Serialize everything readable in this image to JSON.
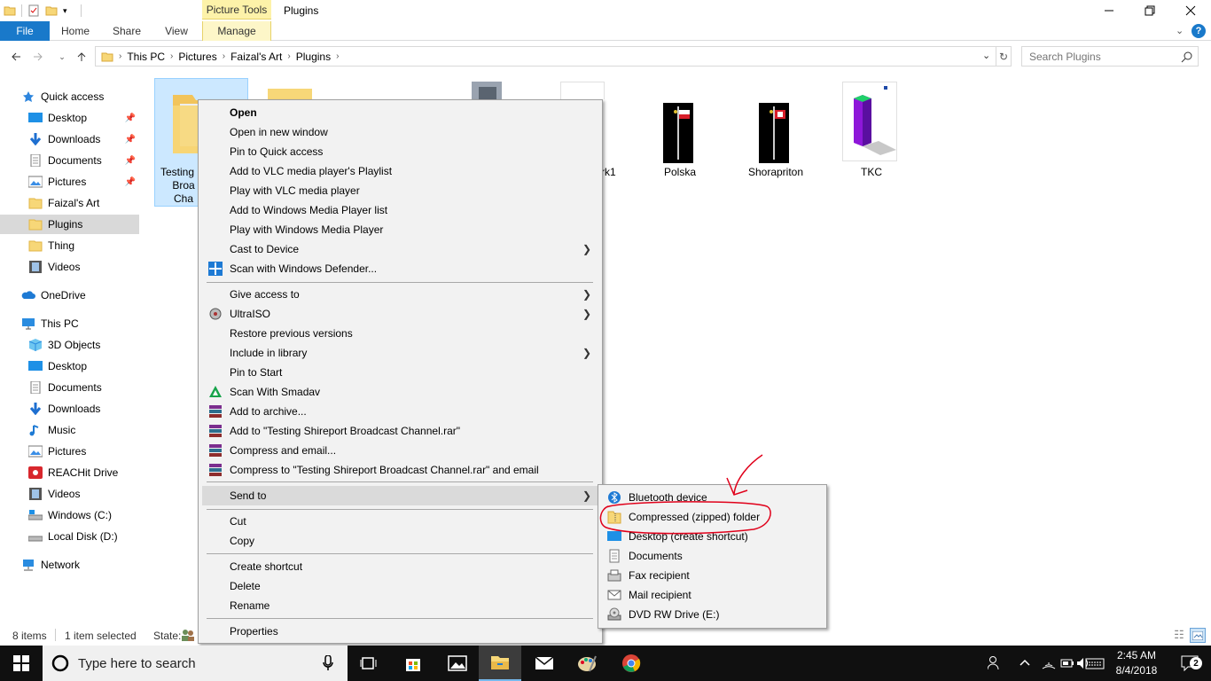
{
  "window": {
    "title": "Plugins",
    "context_tab_group": "Picture Tools",
    "controls": {
      "minimize": "—",
      "maximize": "☐",
      "close": "✕"
    }
  },
  "ribbon": {
    "tabs": [
      {
        "label": "File"
      },
      {
        "label": "Home"
      },
      {
        "label": "Share"
      },
      {
        "label": "View"
      },
      {
        "label": "Manage"
      }
    ]
  },
  "address": {
    "crumbs": [
      "This PC",
      "Pictures",
      "Faizal's Art",
      "Plugins"
    ],
    "search_placeholder": "Search Plugins"
  },
  "nav": {
    "items": [
      {
        "label": "Quick access",
        "icon": "star-icon"
      },
      {
        "label": "Desktop",
        "icon": "desktop-icon",
        "pinned": true
      },
      {
        "label": "Downloads",
        "icon": "download-icon",
        "pinned": true
      },
      {
        "label": "Documents",
        "icon": "documents-icon",
        "pinned": true
      },
      {
        "label": "Pictures",
        "icon": "pictures-icon",
        "pinned": true
      },
      {
        "label": "Faizal's Art",
        "icon": "folder-icon"
      },
      {
        "label": "Plugins",
        "icon": "folder-icon",
        "selected": true
      },
      {
        "label": "Thing",
        "icon": "folder-icon"
      },
      {
        "label": "Videos",
        "icon": "videos-icon"
      },
      {
        "label": "OneDrive",
        "icon": "cloud-icon"
      },
      {
        "label": "This PC",
        "icon": "pc-icon"
      },
      {
        "label": "3D Objects",
        "icon": "cube-icon"
      },
      {
        "label": "Desktop",
        "icon": "desktop-icon"
      },
      {
        "label": "Documents",
        "icon": "documents-icon"
      },
      {
        "label": "Downloads",
        "icon": "download-icon"
      },
      {
        "label": "Music",
        "icon": "music-icon"
      },
      {
        "label": "Pictures",
        "icon": "pictures-icon"
      },
      {
        "label": "REACHit Drive",
        "icon": "reachit-icon"
      },
      {
        "label": "Videos",
        "icon": "videos-icon"
      },
      {
        "label": "Windows (C:)",
        "icon": "drive-icon"
      },
      {
        "label": "Local Disk (D:)",
        "icon": "drive-icon"
      },
      {
        "label": "Network",
        "icon": "network-icon"
      }
    ]
  },
  "files": {
    "selected": {
      "line1": "Testing",
      "line2": "Broa",
      "line3": "Cha"
    },
    "partial": "rk1",
    "polska": "Polska",
    "shorapriton": "Shorapriton",
    "tkc": "TKC"
  },
  "status": {
    "count": "8 items",
    "selected": "1 item selected",
    "state": "State:"
  },
  "context_menu": {
    "items": [
      {
        "label": "Open",
        "bold": true
      },
      {
        "label": "Open in new window"
      },
      {
        "label": "Pin to Quick access"
      },
      {
        "label": "Add to VLC media player's Playlist"
      },
      {
        "label": "Play with VLC media player"
      },
      {
        "label": "Add to Windows Media Player list"
      },
      {
        "label": "Play with Windows Media Player"
      },
      {
        "label": "Cast to Device",
        "submenu": true
      },
      {
        "label": "Scan with Windows Defender...",
        "icon": "defender-icon"
      },
      {
        "label": "Give access to",
        "submenu": true
      },
      {
        "label": "UltraISO",
        "icon": "ultraiso-icon",
        "submenu": true
      },
      {
        "label": "Restore previous versions"
      },
      {
        "label": "Include in library",
        "submenu": true
      },
      {
        "label": "Pin to Start"
      },
      {
        "label": "Scan With Smadav",
        "icon": "smadav-icon"
      },
      {
        "label": "Add to archive...",
        "icon": "winrar-icon"
      },
      {
        "label": "Add to \"Testing Shireport Broadcast Channel.rar\"",
        "icon": "winrar-icon"
      },
      {
        "label": "Compress and email...",
        "icon": "winrar-icon"
      },
      {
        "label": "Compress to \"Testing Shireport Broadcast Channel.rar\" and email",
        "icon": "winrar-icon"
      },
      {
        "label": "Send to",
        "submenu": true,
        "highlighted": true
      },
      {
        "label": "Cut"
      },
      {
        "label": "Copy"
      },
      {
        "label": "Create shortcut"
      },
      {
        "label": "Delete"
      },
      {
        "label": "Rename"
      },
      {
        "label": "Properties"
      }
    ]
  },
  "send_to": {
    "items": [
      {
        "label": "Bluetooth device",
        "icon": "bluetooth-icon"
      },
      {
        "label": "Compressed (zipped) folder",
        "icon": "zip-folder-icon"
      },
      {
        "label": "Desktop (create shortcut)",
        "icon": "desktop-icon"
      },
      {
        "label": "Documents",
        "icon": "documents-icon"
      },
      {
        "label": "Fax recipient",
        "icon": "fax-icon"
      },
      {
        "label": "Mail recipient",
        "icon": "mail-icon"
      },
      {
        "label": "DVD RW Drive (E:)",
        "icon": "dvd-icon"
      }
    ]
  },
  "taskbar": {
    "search_placeholder": "Type here to search",
    "time": "2:45 AM",
    "date": "8/4/2018",
    "notifications": "2"
  },
  "colors": {
    "accent": "#1979ca",
    "annotation": "#e0001a",
    "taskbar": "#101010"
  }
}
